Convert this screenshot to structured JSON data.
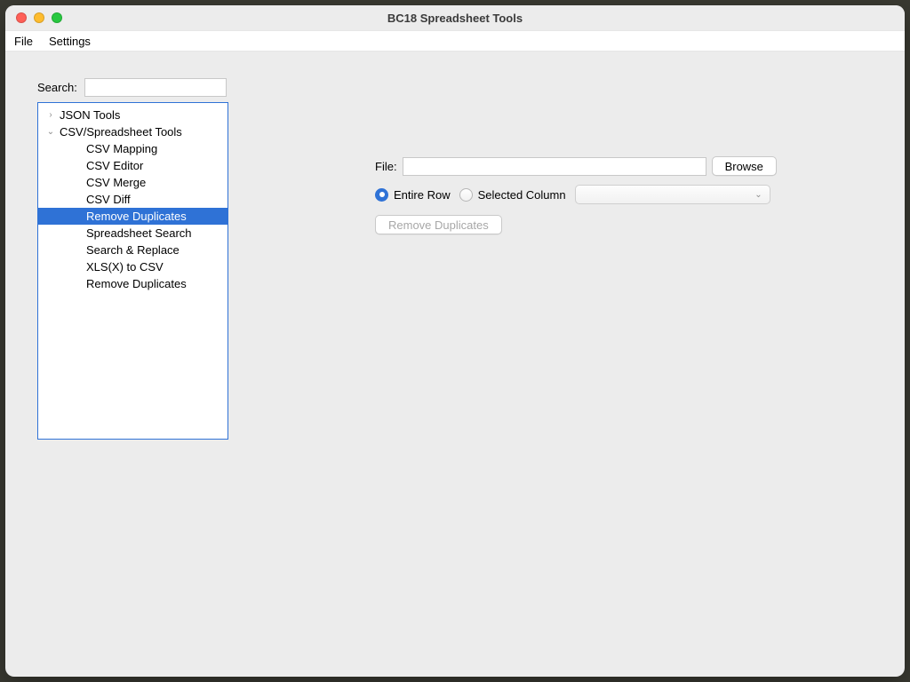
{
  "window": {
    "title": "BC18 Spreadsheet Tools"
  },
  "menubar": {
    "items": [
      "File",
      "Settings"
    ]
  },
  "sidebar": {
    "search_label": "Search:",
    "search_value": "",
    "tree": [
      {
        "label": "JSON Tools",
        "depth": 0,
        "expanded": false,
        "hasChildren": true,
        "selected": false
      },
      {
        "label": "CSV/Spreadsheet Tools",
        "depth": 0,
        "expanded": true,
        "hasChildren": true,
        "selected": false
      },
      {
        "label": "CSV Mapping",
        "depth": 1,
        "hasChildren": false,
        "selected": false
      },
      {
        "label": "CSV Editor",
        "depth": 1,
        "hasChildren": false,
        "selected": false
      },
      {
        "label": "CSV Merge",
        "depth": 1,
        "hasChildren": false,
        "selected": false
      },
      {
        "label": "CSV Diff",
        "depth": 1,
        "hasChildren": false,
        "selected": false
      },
      {
        "label": "Remove Duplicates",
        "depth": 1,
        "hasChildren": false,
        "selected": true
      },
      {
        "label": "Spreadsheet Search",
        "depth": 1,
        "hasChildren": false,
        "selected": false
      },
      {
        "label": "Search & Replace",
        "depth": 1,
        "hasChildren": false,
        "selected": false
      },
      {
        "label": "XLS(X) to CSV",
        "depth": 1,
        "hasChildren": false,
        "selected": false
      },
      {
        "label": "Remove Duplicates",
        "depth": 1,
        "hasChildren": false,
        "selected": false
      }
    ]
  },
  "main": {
    "file_label": "File:",
    "file_value": "",
    "browse_label": "Browse",
    "radios": {
      "entire_row": "Entire Row",
      "selected_column": "Selected Column",
      "selected_value": "entire_row"
    },
    "column_combo_value": "",
    "action_label": "Remove Duplicates",
    "action_enabled": false
  },
  "colors": {
    "selection": "#2f72d6"
  }
}
